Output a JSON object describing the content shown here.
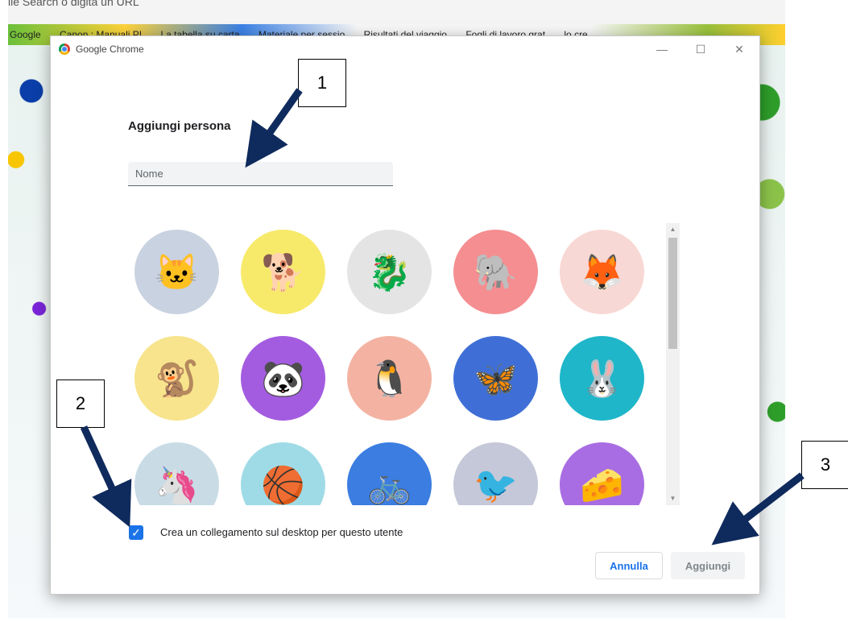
{
  "browser": {
    "omnibox_text": "ile Search o digita un URL",
    "bookmarks": [
      {
        "label": "Google",
        "icon": "google-icon"
      },
      {
        "label": "Canon : Manuali PI",
        "icon": "site-icon"
      },
      {
        "label": "La tabella su carta",
        "icon": "site-icon"
      },
      {
        "label": "Materiale per sessio",
        "icon": "site-icon"
      },
      {
        "label": "Risultati del viaggio",
        "icon": "site-icon"
      },
      {
        "label": "Fogli di lavoro grat",
        "icon": "site-icon"
      },
      {
        "label": "lo cre",
        "icon": "site-icon"
      }
    ]
  },
  "dialog": {
    "window_title": "Google Chrome",
    "heading": "Aggiungi persona",
    "name_placeholder": "Nome",
    "avatars": [
      {
        "name": "origami cat",
        "bg": "#c9d2e0",
        "glyph": "🐱"
      },
      {
        "name": "origami fox dog",
        "bg": "#f7ea6b",
        "glyph": "🐕"
      },
      {
        "name": "origami dragon",
        "bg": "#e4e4e4",
        "glyph": "🐉"
      },
      {
        "name": "origami elephant",
        "bg": "#f58e91",
        "glyph": "🐘"
      },
      {
        "name": "origami fox",
        "bg": "#f8d8d4",
        "glyph": "🦊"
      },
      {
        "name": "origami monkey",
        "bg": "#f7e48c",
        "glyph": "🐒"
      },
      {
        "name": "origami panda",
        "bg": "#a35ce0",
        "glyph": "🐼"
      },
      {
        "name": "origami penguin",
        "bg": "#f4b3a2",
        "glyph": "🐧"
      },
      {
        "name": "origami butterfly",
        "bg": "#3f6fd6",
        "glyph": "🦋"
      },
      {
        "name": "origami rabbit",
        "bg": "#1fb6c9",
        "glyph": "🐰"
      },
      {
        "name": "origami unicorn",
        "bg": "#c9dce6",
        "glyph": "🦄"
      },
      {
        "name": "basketball",
        "bg": "#9fdbe6",
        "glyph": "🏀"
      },
      {
        "name": "bicycle",
        "bg": "#3b7de0",
        "glyph": "🚲"
      },
      {
        "name": "bird",
        "bg": "#c4c8d8",
        "glyph": "🐦"
      },
      {
        "name": "cheese",
        "bg": "#a86de2",
        "glyph": "🧀"
      }
    ],
    "checkbox_checked": true,
    "checkbox_label": "Crea un collegamento sul desktop per questo utente",
    "cancel_label": "Annulla",
    "add_label": "Aggiungi",
    "accent_color": "#1a73e8"
  },
  "callouts": [
    "1",
    "2",
    "3"
  ]
}
